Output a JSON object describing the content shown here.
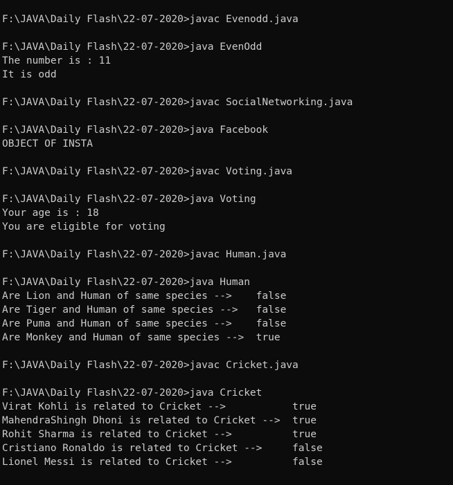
{
  "console": {
    "colors": {
      "background": "#0c0c0c",
      "text": "#cccccc"
    },
    "lines": [
      "F:\\JAVA\\Daily Flash\\22-07-2020>javac Evenodd.java",
      "",
      "F:\\JAVA\\Daily Flash\\22-07-2020>java EvenOdd",
      "The number is : 11",
      "It is odd",
      "",
      "F:\\JAVA\\Daily Flash\\22-07-2020>javac SocialNetworking.java",
      "",
      "F:\\JAVA\\Daily Flash\\22-07-2020>java Facebook",
      "OBJECT OF INSTA",
      "",
      "F:\\JAVA\\Daily Flash\\22-07-2020>javac Voting.java",
      "",
      "F:\\JAVA\\Daily Flash\\22-07-2020>java Voting",
      "Your age is : 18",
      "You are eligible for voting",
      "",
      "F:\\JAVA\\Daily Flash\\22-07-2020>javac Human.java",
      "",
      "F:\\JAVA\\Daily Flash\\22-07-2020>java Human",
      "Are Lion and Human of same species -->    false",
      "Are Tiger and Human of same species -->   false",
      "Are Puma and Human of same species -->    false",
      "Are Monkey and Human of same species -->  true",
      "",
      "F:\\JAVA\\Daily Flash\\22-07-2020>javac Cricket.java",
      "",
      "F:\\JAVA\\Daily Flash\\22-07-2020>java Cricket",
      "Virat Kohli is related to Cricket -->           true",
      "MahendraShingh Dhoni is related to Cricket -->  true",
      "Rohit Sharma is related to Cricket -->          true",
      "Cristiano Ronaldo is related to Cricket -->     false",
      "Lionel Messi is related to Cricket -->          false"
    ]
  }
}
